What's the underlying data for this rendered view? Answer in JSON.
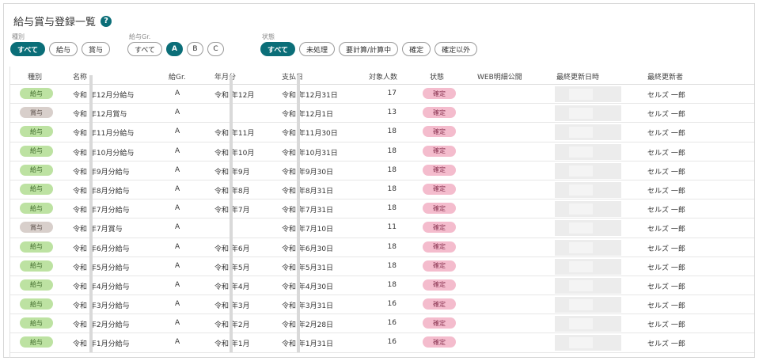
{
  "title": "給与賞与登録一覧",
  "help_icon": "?",
  "filters": {
    "type": {
      "label": "種別",
      "options": [
        "すべて",
        "給与",
        "賞与"
      ],
      "active": 0
    },
    "group": {
      "label": "給与Gr.",
      "options": [
        "すべて",
        "A",
        "B",
        "C"
      ],
      "active": 1
    },
    "status": {
      "label": "状態",
      "options": [
        "すべて",
        "未処理",
        "要計算/計算中",
        "確定",
        "確定以外"
      ],
      "active": 0
    }
  },
  "columns": [
    "種別",
    "名称",
    "給Gr.",
    "年月分",
    "支払日",
    "対象人数",
    "状態",
    "WEB明細公開",
    "最終更新日時",
    "最終更新者"
  ],
  "colors": {
    "accent": "#0b6e78",
    "kyuyo_badge": "#bde2a2",
    "shoyo_badge": "#d8cfcb",
    "status_badge": "#f4bccd"
  },
  "rows": [
    {
      "type": "給与",
      "kind": "kyuyo",
      "name": "令和 年12月分給与",
      "group": "A",
      "ym": "令和 年12月",
      "pay": "令和 年12月31日",
      "count": "17",
      "status": "確定",
      "user": "セルズ 一郎"
    },
    {
      "type": "賞与",
      "kind": "shoyo",
      "name": "令和 年12月賞与",
      "group": "A",
      "ym": "",
      "pay": "令和 年12月1日",
      "count": "13",
      "status": "確定",
      "user": "セルズ 一郎"
    },
    {
      "type": "給与",
      "kind": "kyuyo",
      "name": "令和 年11月分給与",
      "group": "A",
      "ym": "令和 年11月",
      "pay": "令和 年11月30日",
      "count": "18",
      "status": "確定",
      "user": "セルズ 一郎"
    },
    {
      "type": "給与",
      "kind": "kyuyo",
      "name": "令和 年10月分給与",
      "group": "A",
      "ym": "令和 年10月",
      "pay": "令和 年10月31日",
      "count": "18",
      "status": "確定",
      "user": "セルズ 一郎"
    },
    {
      "type": "給与",
      "kind": "kyuyo",
      "name": "令和 年9月分給与",
      "group": "A",
      "ym": "令和 年9月",
      "pay": "令和 年9月30日",
      "count": "18",
      "status": "確定",
      "user": "セルズ 一郎"
    },
    {
      "type": "給与",
      "kind": "kyuyo",
      "name": "令和 年8月分給与",
      "group": "A",
      "ym": "令和 年8月",
      "pay": "令和 年8月31日",
      "count": "18",
      "status": "確定",
      "user": "セルズ 一郎"
    },
    {
      "type": "給与",
      "kind": "kyuyo",
      "name": "令和 年7月分給与",
      "group": "A",
      "ym": "令和 年7月",
      "pay": "令和 年7月31日",
      "count": "18",
      "status": "確定",
      "user": "セルズ 一郎"
    },
    {
      "type": "賞与",
      "kind": "shoyo",
      "name": "令和 年7月賞与",
      "group": "A",
      "ym": "",
      "pay": "令和 年7月10日",
      "count": "11",
      "status": "確定",
      "user": "セルズ 一郎"
    },
    {
      "type": "給与",
      "kind": "kyuyo",
      "name": "令和 年6月分給与",
      "group": "A",
      "ym": "令和 年6月",
      "pay": "令和 年6月30日",
      "count": "18",
      "status": "確定",
      "user": "セルズ 一郎"
    },
    {
      "type": "給与",
      "kind": "kyuyo",
      "name": "令和 年5月分給与",
      "group": "A",
      "ym": "令和 年5月",
      "pay": "令和 年5月31日",
      "count": "18",
      "status": "確定",
      "user": "セルズ 一郎"
    },
    {
      "type": "給与",
      "kind": "kyuyo",
      "name": "令和 年4月分給与",
      "group": "A",
      "ym": "令和 年4月",
      "pay": "令和 年4月30日",
      "count": "18",
      "status": "確定",
      "user": "セルズ 一郎"
    },
    {
      "type": "給与",
      "kind": "kyuyo",
      "name": "令和 年3月分給与",
      "group": "A",
      "ym": "令和 年3月",
      "pay": "令和 年3月31日",
      "count": "16",
      "status": "確定",
      "user": "セルズ 一郎"
    },
    {
      "type": "給与",
      "kind": "kyuyo",
      "name": "令和 年2月分給与",
      "group": "A",
      "ym": "令和 年2月",
      "pay": "令和 年2月28日",
      "count": "16",
      "status": "確定",
      "user": "セルズ 一郎"
    },
    {
      "type": "給与",
      "kind": "kyuyo",
      "name": "令和 年1月分給与",
      "group": "A",
      "ym": "令和 年1月",
      "pay": "令和 年1月31日",
      "count": "16",
      "status": "確定",
      "user": "セルズ 一郎"
    }
  ]
}
